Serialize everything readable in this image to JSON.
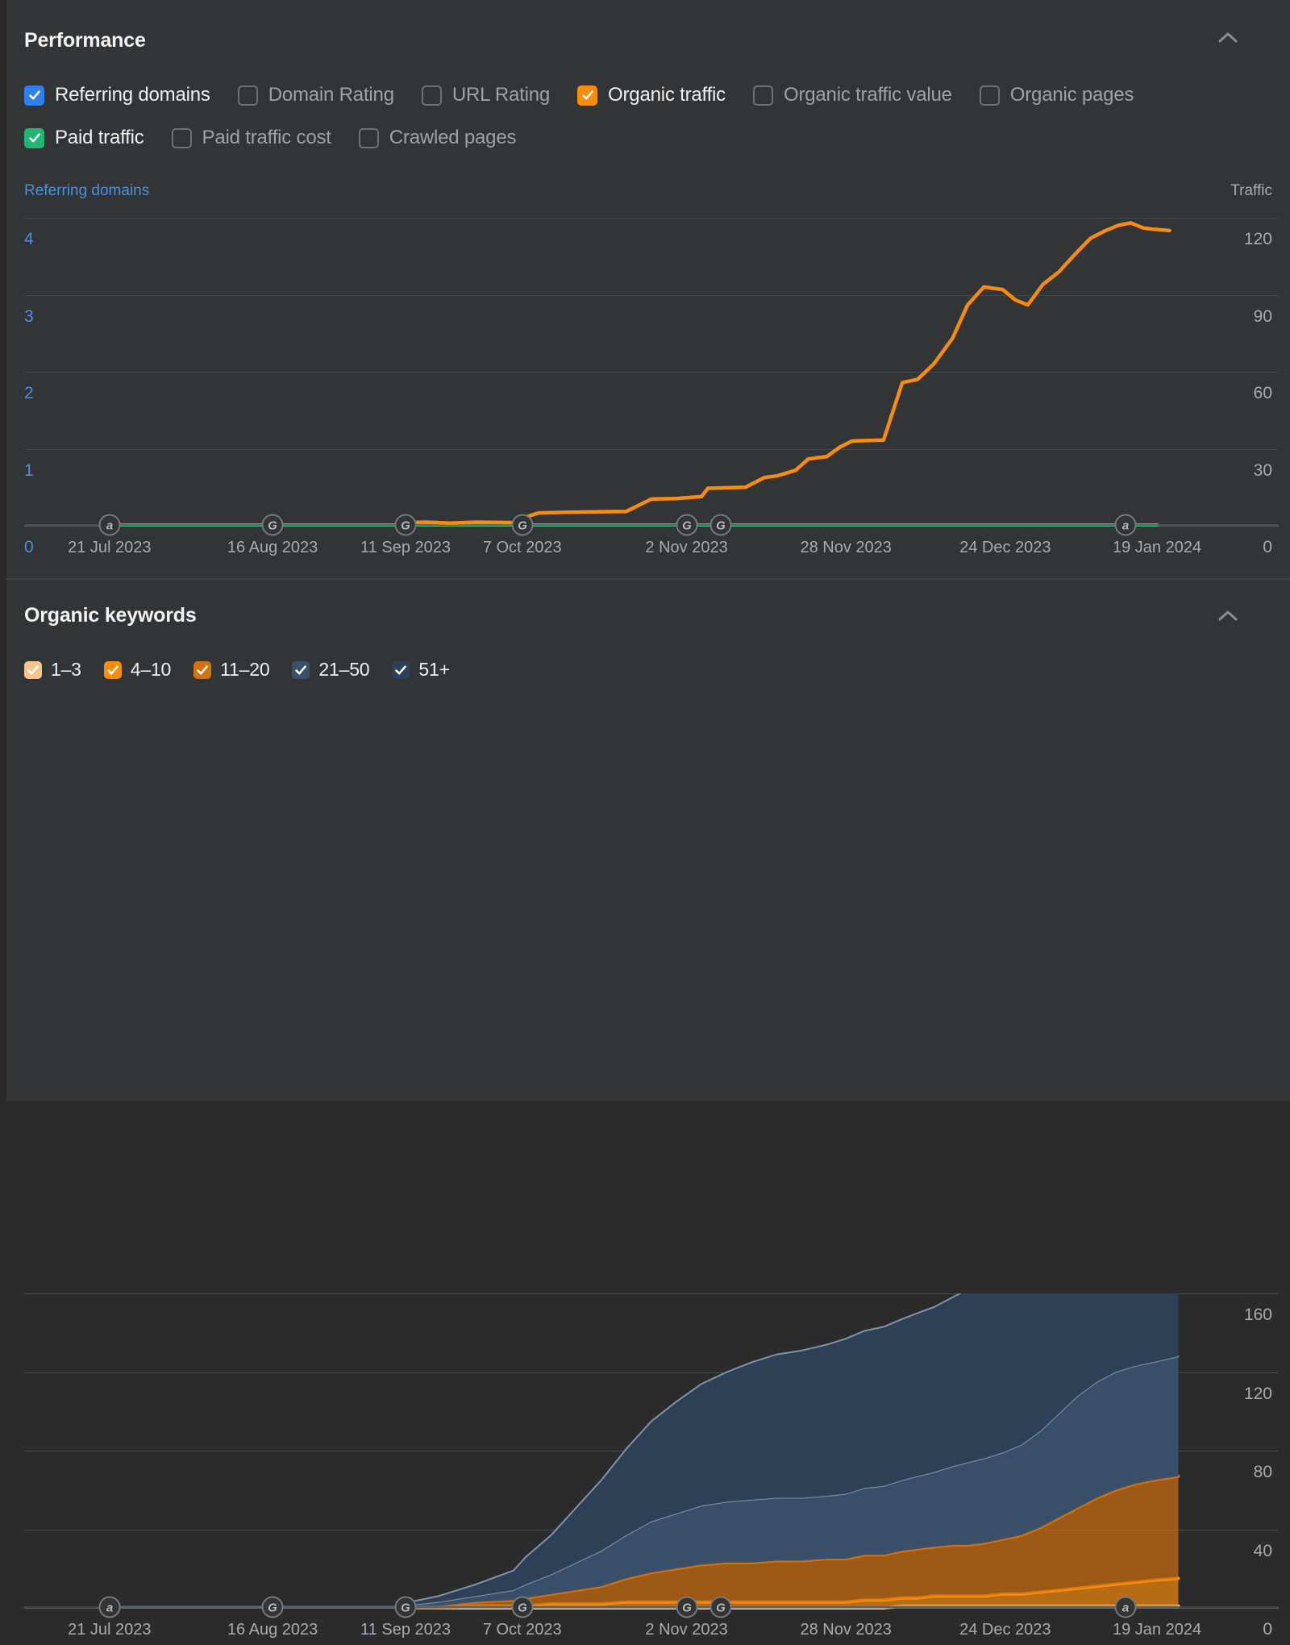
{
  "colors": {
    "panel_bg": "#333435",
    "page_bg": "#2f3031",
    "blue": "#4a90e2",
    "orange": "#f98c0a",
    "green": "#3dc07c",
    "grid": "#48494a",
    "text_active": "#f0f0f0",
    "text_inactive": "#9fa1a3",
    "kw_1_3": "#f7c58c",
    "kw_4_10": "#f98c0a",
    "kw_11_20": "#d4720d",
    "kw_21_50": "#3a506b",
    "kw_51_plus": "#2e4157"
  },
  "performance": {
    "title": "Performance",
    "collapse_icon": "chevron-up-icon",
    "metrics_row1": [
      {
        "label": "Referring domains",
        "checked": true,
        "color": "#2f80ed"
      },
      {
        "label": "Domain Rating",
        "checked": false,
        "color": ""
      },
      {
        "label": "URL Rating",
        "checked": false,
        "color": ""
      },
      {
        "label": "Organic traffic",
        "checked": true,
        "color": "#f98c0a"
      },
      {
        "label": "Organic traffic value",
        "checked": false,
        "color": ""
      },
      {
        "label": "Organic pages",
        "checked": false,
        "color": ""
      }
    ],
    "metrics_row2": [
      {
        "label": "Paid traffic",
        "checked": true,
        "color": "#22b573"
      },
      {
        "label": "Paid traffic cost",
        "checked": false,
        "color": ""
      },
      {
        "label": "Crawled pages",
        "checked": false,
        "color": ""
      }
    ],
    "axis_left_title": "Referring domains",
    "axis_right_title": "Traffic",
    "y_left_ticks": [
      "4",
      "3",
      "2",
      "1",
      "0"
    ],
    "y_right_ticks": [
      "120",
      "90",
      "60",
      "30",
      "0"
    ],
    "x_ticks": [
      "21 Jul 2023",
      "16 Aug 2023",
      "11 Sep 2023",
      "7 Oct 2023",
      "2 Nov 2023",
      "28 Nov 2023",
      "24 Dec 2023",
      "19 Jan 2024"
    ],
    "event_markers": [
      {
        "letter": "a",
        "x_frac": 0.068
      },
      {
        "letter": "G",
        "x_frac": 0.198
      },
      {
        "letter": "G",
        "x_frac": 0.304
      },
      {
        "letter": "G",
        "x_frac": 0.397
      },
      {
        "letter": "G",
        "x_frac": 0.528
      },
      {
        "letter": "G",
        "x_frac": 0.555
      },
      {
        "letter": "a",
        "x_frac": 0.878
      }
    ]
  },
  "organic_keywords": {
    "title": "Organic keywords",
    "collapse_icon": "chevron-up-icon",
    "legend": [
      {
        "label": "1–3",
        "checked": true,
        "color": "#f7c58c"
      },
      {
        "label": "4–10",
        "checked": true,
        "color": "#f98c0a"
      },
      {
        "label": "11–20",
        "checked": true,
        "color": "#d4720d"
      },
      {
        "label": "21–50",
        "checked": true,
        "color": "#3a506b"
      },
      {
        "label": "51+",
        "checked": true,
        "color": "#2e4157"
      }
    ],
    "y_right_ticks": [
      "160",
      "120",
      "80",
      "40",
      "0"
    ],
    "x_ticks": [
      "21 Jul 2023",
      "16 Aug 2023",
      "11 Sep 2023",
      "7 Oct 2023",
      "2 Nov 2023",
      "28 Nov 2023",
      "24 Dec 2023",
      "19 Jan 2024"
    ],
    "event_markers": [
      {
        "letter": "a",
        "x_frac": 0.068
      },
      {
        "letter": "G",
        "x_frac": 0.198
      },
      {
        "letter": "G",
        "x_frac": 0.304
      },
      {
        "letter": "G",
        "x_frac": 0.397
      },
      {
        "letter": "G",
        "x_frac": 0.528
      },
      {
        "letter": "G",
        "x_frac": 0.555
      },
      {
        "letter": "a",
        "x_frac": 0.878
      }
    ]
  },
  "chart_data": [
    {
      "id": "performance-chart",
      "type": "line",
      "title": "Performance",
      "xlabel": "",
      "ylabel": "Referring domains",
      "y2label": "Traffic",
      "grid": true,
      "legend_position": "top",
      "ylim": [
        0,
        4
      ],
      "y2lim": [
        0,
        120
      ],
      "x_tick_labels": [
        "21 Jul 2023",
        "16 Aug 2023",
        "11 Sep 2023",
        "7 Oct 2023",
        "2 Nov 2023",
        "28 Nov 2023",
        "24 Dec 2023",
        "19 Jan 2024"
      ],
      "x_tick_fracs": [
        0.068,
        0.198,
        0.304,
        0.397,
        0.528,
        0.655,
        0.782,
        0.903
      ],
      "series": [
        {
          "name": "Referring domains",
          "axis": "left",
          "color": "#4a90e2",
          "x": [
            0.0,
            1.0
          ],
          "values": [
            0,
            0
          ]
        },
        {
          "name": "Paid traffic",
          "axis": "right",
          "color": "#3dc07c",
          "x": [
            0.068,
            0.903
          ],
          "values": [
            0,
            0
          ]
        },
        {
          "name": "Organic traffic",
          "axis": "right",
          "color": "#f98c0a",
          "x": [
            0.3,
            0.32,
            0.34,
            0.36,
            0.38,
            0.395,
            0.4,
            0.41,
            0.43,
            0.455,
            0.48,
            0.5,
            0.52,
            0.54,
            0.545,
            0.56,
            0.575,
            0.59,
            0.6,
            0.615,
            0.625,
            0.64,
            0.65,
            0.66,
            0.672,
            0.685,
            0.7,
            0.712,
            0.725,
            0.74,
            0.752,
            0.765,
            0.78,
            0.79,
            0.8,
            0.812,
            0.825,
            0.838,
            0.85,
            0.862,
            0.872,
            0.882,
            0.892,
            0.9,
            0.913
          ],
          "values": [
            1.2,
            1.4,
            1.0,
            1.4,
            1.3,
            1.2,
            3.4,
            5.0,
            5.2,
            5.4,
            5.6,
            10.4,
            10.6,
            11.4,
            14.6,
            14.8,
            15.0,
            18.8,
            19.4,
            21.6,
            26.0,
            27.0,
            30.6,
            33.0,
            33.2,
            33.4,
            55.8,
            57.0,
            63.0,
            73.0,
            86.0,
            93.0,
            92.0,
            88.0,
            86.0,
            94.0,
            99.0,
            106.0,
            112.0,
            115.0,
            117.0,
            118.0,
            116.0,
            115.5,
            115.0
          ]
        }
      ]
    },
    {
      "id": "organic-keywords-chart",
      "type": "area",
      "stacked": true,
      "title": "Organic keywords",
      "xlabel": "",
      "ylabel": "",
      "y2label": "",
      "grid": true,
      "legend_position": "top",
      "y2lim": [
        0,
        160
      ],
      "x_tick_labels": [
        "21 Jul 2023",
        "16 Aug 2023",
        "11 Sep 2023",
        "7 Oct 2023",
        "2 Nov 2023",
        "28 Nov 2023",
        "24 Dec 2023",
        "19 Jan 2024"
      ],
      "x_tick_fracs": [
        0.068,
        0.198,
        0.304,
        0.397,
        0.528,
        0.655,
        0.782,
        0.903
      ],
      "x": [
        0.3,
        0.33,
        0.36,
        0.39,
        0.4,
        0.42,
        0.44,
        0.46,
        0.48,
        0.5,
        0.52,
        0.54,
        0.56,
        0.58,
        0.6,
        0.62,
        0.64,
        0.655,
        0.67,
        0.685,
        0.7,
        0.712,
        0.725,
        0.74,
        0.752,
        0.765,
        0.78,
        0.795,
        0.81,
        0.825,
        0.84,
        0.855,
        0.87,
        0.885,
        0.9,
        0.92
      ],
      "series": [
        {
          "name": "1–3",
          "color": "#f7c58c",
          "values": [
            0,
            0,
            0,
            0,
            0,
            0,
            0,
            0,
            0,
            0,
            0,
            0,
            0,
            0,
            0,
            0,
            0,
            0,
            0,
            0,
            1,
            1,
            1,
            1,
            1,
            1,
            1,
            1,
            1,
            1,
            1,
            1,
            1,
            1,
            1,
            1
          ]
        },
        {
          "name": "4–10",
          "color": "#f98c0a",
          "values": [
            0,
            0,
            1,
            1,
            1,
            2,
            2,
            2,
            3,
            3,
            3,
            3,
            3,
            3,
            3,
            3,
            3,
            3,
            4,
            4,
            4,
            4,
            5,
            5,
            5,
            5,
            6,
            6,
            7,
            8,
            9,
            10,
            11,
            12,
            13,
            14
          ]
        },
        {
          "name": "11–20",
          "color": "#d4720d",
          "values": [
            0,
            1,
            2,
            3,
            4,
            5,
            7,
            9,
            12,
            15,
            17,
            19,
            20,
            20,
            21,
            21,
            22,
            22,
            23,
            23,
            24,
            25,
            25,
            26,
            26,
            27,
            28,
            30,
            33,
            37,
            41,
            45,
            48,
            50,
            51,
            52
          ]
        },
        {
          "name": "21–50",
          "color": "#3a506b",
          "values": [
            1,
            2,
            3,
            5,
            7,
            10,
            14,
            18,
            22,
            26,
            28,
            30,
            31,
            32,
            32,
            32,
            32,
            33,
            34,
            35,
            36,
            37,
            38,
            40,
            42,
            43,
            44,
            46,
            49,
            53,
            57,
            59,
            60,
            60,
            60,
            61
          ]
        },
        {
          "name": "51+",
          "color": "#2e4157",
          "values": [
            1,
            3,
            6,
            10,
            14,
            20,
            28,
            36,
            44,
            51,
            57,
            62,
            66,
            70,
            73,
            75,
            77,
            79,
            80,
            81,
            82,
            83,
            84,
            86,
            88,
            90,
            92,
            95,
            97,
            98,
            99,
            100,
            101,
            102,
            103,
            104
          ]
        }
      ]
    }
  ]
}
